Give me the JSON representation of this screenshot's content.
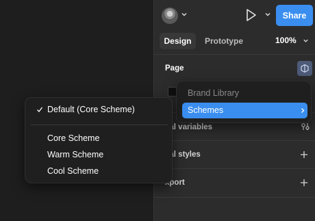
{
  "header": {
    "share_label": "Share"
  },
  "tabs": [
    {
      "label": "Design",
      "active": true
    },
    {
      "label": "Prototype",
      "active": false
    }
  ],
  "zoom": "100%",
  "sections": {
    "page": "Page",
    "local_variables": "cal variables",
    "local_styles": "cal styles",
    "export": "xport"
  },
  "library_menu": {
    "items": [
      {
        "label": "Brand Library",
        "muted": true
      },
      {
        "label": "Schemes",
        "highlighted": true,
        "submenu": true
      }
    ]
  },
  "scheme_menu": {
    "selected": "Default (Core Scheme)",
    "options": [
      "Core Scheme",
      "Warm Scheme",
      "Cool Scheme"
    ]
  },
  "colors": {
    "accent": "#3a8ef0",
    "panel": "#2c2c2c",
    "canvas": "#1e1e1e",
    "menu": "#1f1f1f"
  }
}
